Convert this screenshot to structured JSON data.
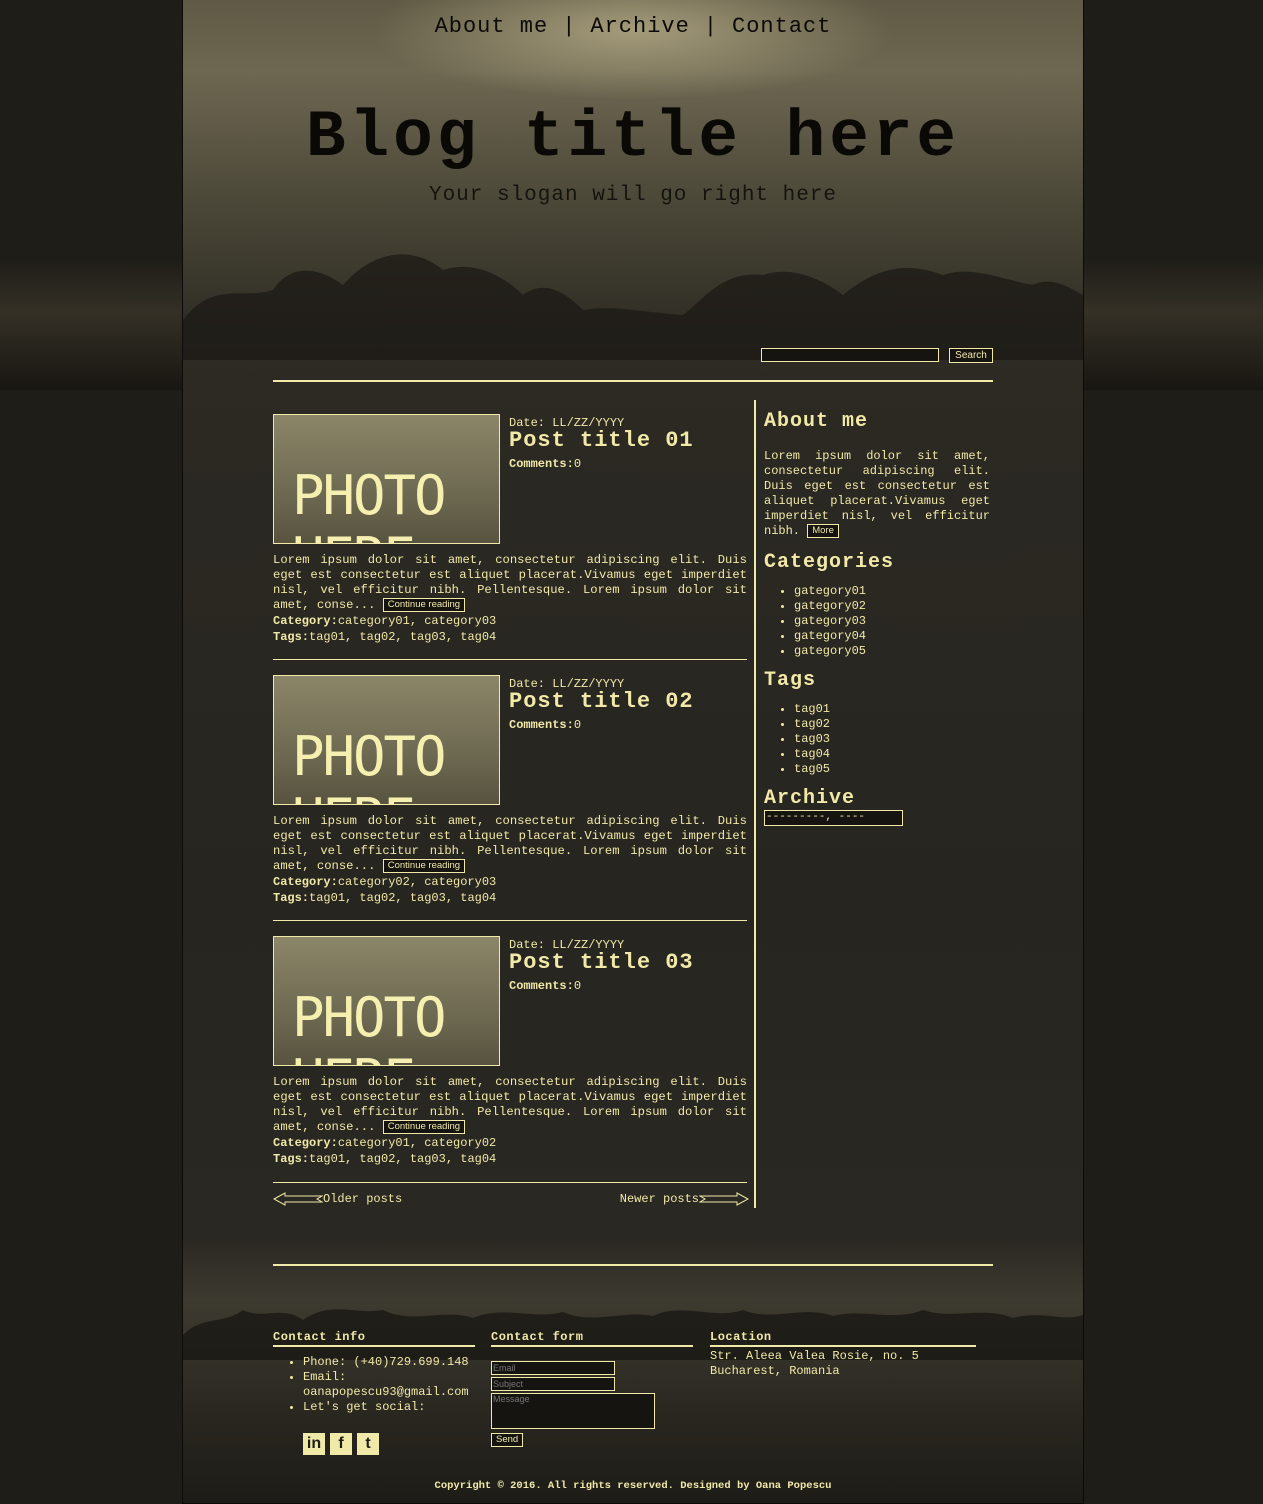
{
  "nav": {
    "items": [
      "About me",
      "Archive",
      "Contact"
    ],
    "separator": "|"
  },
  "header": {
    "title": "Blog title here",
    "slogan": "Your slogan will go right here"
  },
  "search": {
    "button_label": "Search",
    "value": ""
  },
  "posts": [
    {
      "date": "Date: LL/ZZ/YYYY",
      "title": "Post title 01",
      "comments_label": "Comments:",
      "comments_count": "0",
      "photo_label": "PHOTO HERE",
      "excerpt": "Lorem ipsum dolor sit amet, consectetur adipiscing elit. Duis eget est consectetur est aliquet placerat.Vivamus eget imperdiet nisl, vel efficitur nibh. Pellentesque. Lorem ipsum dolor sit amet, conse...",
      "continue_label": "Continue reading",
      "category_label": "Category:",
      "categories": "category01, category03",
      "tags_label": "Tags:",
      "tags": "tag01, tag02, tag03, tag04"
    },
    {
      "date": "Date: LL/ZZ/YYYY",
      "title": "Post title 02",
      "comments_label": "Comments:",
      "comments_count": "0",
      "photo_label": "PHOTO HERE",
      "excerpt": "Lorem ipsum dolor sit amet, consectetur adipiscing elit. Duis eget est consectetur est aliquet placerat.Vivamus eget imperdiet nisl, vel efficitur nibh. Pellentesque. Lorem ipsum dolor sit amet, conse...",
      "continue_label": "Continue reading",
      "category_label": "Category:",
      "categories": "category02, category03",
      "tags_label": "Tags:",
      "tags": "tag01, tag02, tag03, tag04"
    },
    {
      "date": "Date: LL/ZZ/YYYY",
      "title": "Post title 03",
      "comments_label": "Comments:",
      "comments_count": "0",
      "photo_label": "PHOTO HERE",
      "excerpt": "Lorem ipsum dolor sit amet, consectetur adipiscing elit. Duis eget est consectetur est aliquet placerat.Vivamus eget imperdiet nisl, vel efficitur nibh. Pellentesque. Lorem ipsum dolor sit amet, conse...",
      "continue_label": "Continue reading",
      "category_label": "Category:",
      "categories": "category01, category02",
      "tags_label": "Tags:",
      "tags": "tag01, tag02, tag03, tag04"
    }
  ],
  "pager": {
    "older": "Older posts",
    "newer": "Newer posts"
  },
  "sidebar": {
    "about_title": "About me",
    "about_text": "Lorem ipsum dolor sit amet, consectetur adipiscing elit. Duis eget est consectetur est aliquet placerat.Vivamus eget imperdiet nisl, vel efficitur nibh.",
    "more_label": "More",
    "categories_title": "Categories",
    "categories": [
      "gategory01",
      "gategory02",
      "gategory03",
      "gategory04",
      "gategory05"
    ],
    "tags_title": "Tags",
    "tags": [
      "tag01",
      "tag02",
      "tag03",
      "tag04",
      "tag05"
    ],
    "archive_title": "Archive",
    "archive_selected": "---------, ----"
  },
  "footer": {
    "contact_title": "Contact info",
    "phone": "Phone: (+40)729.699.148",
    "email_label": "Email:",
    "email": "oanapopescu93@gmail.com",
    "social_label": "Let's get social:",
    "social": [
      "in",
      "f",
      "t"
    ],
    "form_title": "Contact form",
    "email_placeholder": "Email",
    "subject_placeholder": "Subject",
    "message_placeholder": "Message",
    "send_label": "Send",
    "location_title": "Location",
    "address_line1": "Str. Aleea Valea Rosie, no. 5",
    "address_line2": "Bucharest, Romania"
  },
  "copyright": "Copyright © 2016. All rights reserved. Designed by Oana Popescu",
  "colors": {
    "accent": "#f1e9a8",
    "page_bg": "#1f1d18",
    "panel": "#2a2822"
  }
}
